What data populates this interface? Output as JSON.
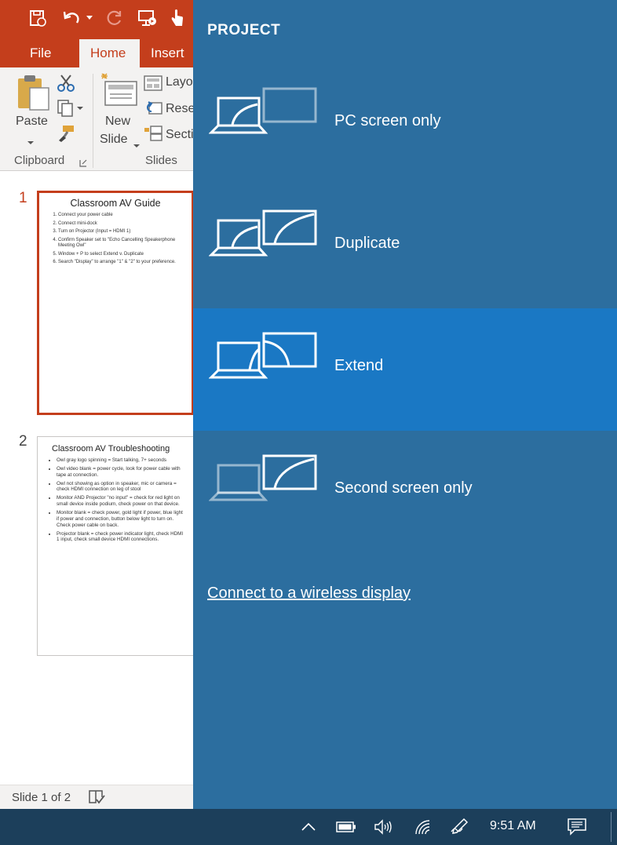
{
  "ppt": {
    "tabs": [
      "File",
      "Home",
      "Insert"
    ],
    "ribbon": {
      "paste_label": "Paste",
      "new_slide_label_1": "New",
      "new_slide_label_2": "Slide",
      "layout_label": "Layo",
      "reset_label": "Rese",
      "section_label": "Secti",
      "clipboard_group": "Clipboard",
      "slides_group": "Slides"
    },
    "slides": [
      {
        "number": "1",
        "title": "Classroom AV Guide",
        "items": [
          "Connect your power cable",
          "Connect mini-dock",
          "Turn on Projector (Input = HDMI 1)",
          "Confirm Speaker set to \"Echo Cancelling Speakerphone Meeting Owl\"",
          "Window + P to select Extend v. Duplicate",
          "Search \"Display\" to arrange \"1\" & \"2\" to your preference."
        ]
      },
      {
        "number": "2",
        "title": "Classroom AV Troubleshooting",
        "items": [
          "Owl gray logo spinning = Start talking, 7+ seconds",
          "Owl video blank = power cycle, look for power cable with tape at connection.",
          "Owl not showing as option in speaker, mic or camera = check HDMI connection on leg of stool",
          "Monitor AND Projector \"no input\" = check for red light on small device inside podium, check power on that device.",
          "Monitor blank = check power, gold light if power, blue light if power and connection, button below light to turn on.  Check power cable on back.",
          "Projector blank = check power indicator light, check HDMI 1 input, check small device HDMI connections."
        ]
      }
    ],
    "status": "Slide 1 of 2"
  },
  "project": {
    "heading": "PROJECT",
    "options": [
      {
        "label": "PC screen only",
        "selected": false
      },
      {
        "label": "Duplicate",
        "selected": false
      },
      {
        "label": "Extend",
        "selected": true
      },
      {
        "label": "Second screen only",
        "selected": false
      }
    ],
    "wireless_link": "Connect to a wireless display"
  },
  "taskbar": {
    "time": "9:51 AM",
    "icons": [
      "chevron-up-icon",
      "battery-icon",
      "volume-icon",
      "wifi-icon",
      "pen-icon",
      "notification-icon"
    ]
  },
  "colors": {
    "ppt_accent": "#c43e1c",
    "flyout_bg": "#2c6e9f",
    "selected_bg": "#1a78c4",
    "taskbar_bg": "#1c3f5b"
  }
}
